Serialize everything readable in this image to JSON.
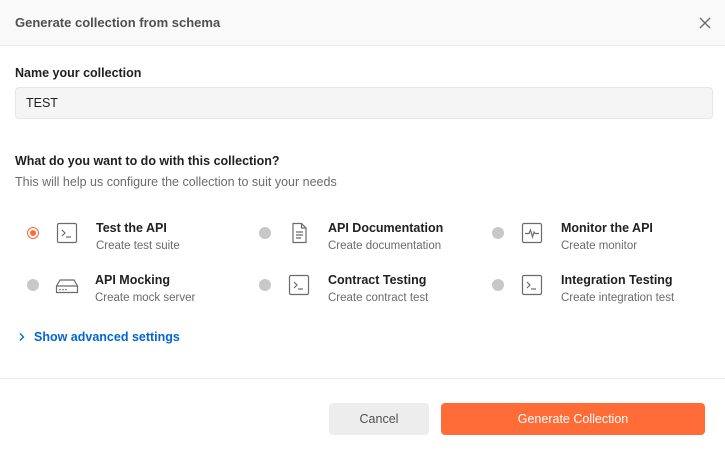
{
  "dialog": {
    "title": "Generate collection from schema"
  },
  "name_field": {
    "label": "Name your collection",
    "value": "TEST"
  },
  "purpose": {
    "question": "What do you want to do with this collection?",
    "hint": "This will help us configure the collection to suit your needs",
    "options": [
      {
        "title": "Test the API",
        "subtitle": "Create test suite",
        "icon": "terminal-icon",
        "selected": true
      },
      {
        "title": "API Documentation",
        "subtitle": "Create documentation",
        "icon": "document-icon",
        "selected": false
      },
      {
        "title": "Monitor the API",
        "subtitle": "Create monitor",
        "icon": "monitor-pulse-icon",
        "selected": false
      },
      {
        "title": "API Mocking",
        "subtitle": "Create mock server",
        "icon": "server-icon",
        "selected": false
      },
      {
        "title": "Contract Testing",
        "subtitle": "Create contract test",
        "icon": "terminal-icon",
        "selected": false
      },
      {
        "title": "Integration Testing",
        "subtitle": "Create integration test",
        "icon": "terminal-icon",
        "selected": false
      }
    ]
  },
  "advanced": {
    "label": "Show advanced settings",
    "icon": "chevron-right-icon"
  },
  "footer": {
    "cancel_label": "Cancel",
    "generate_label": "Generate Collection"
  },
  "colors": {
    "accent": "#ff6c37",
    "link": "#0265d2"
  }
}
